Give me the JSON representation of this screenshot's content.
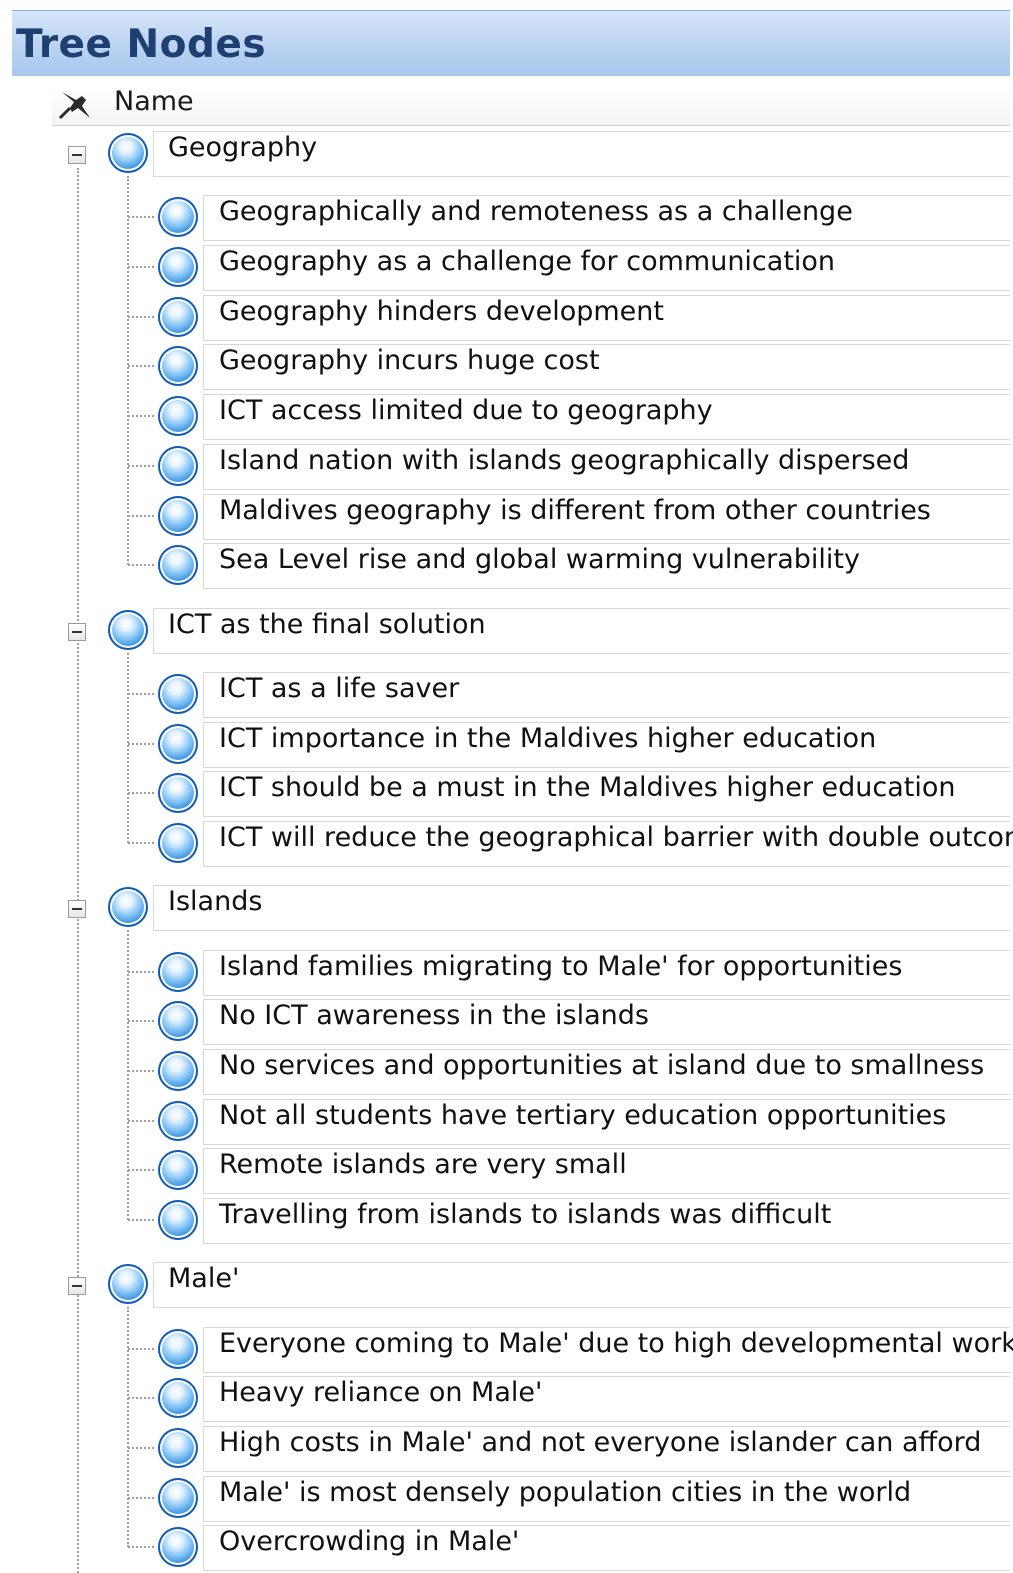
{
  "title": "Tree Nodes",
  "header": {
    "column_name": "Name"
  },
  "groups": [
    {
      "label": "Geography",
      "children": [
        "Geographically and remoteness as a challenge",
        "Geography as a challenge for communication",
        "Geography hinders development",
        "Geography incurs huge cost",
        "ICT access limited due to geography",
        "Island nation with islands geographically dispersed",
        "Maldives geography is different from other countries",
        "Sea Level rise and global warming vulnerability"
      ]
    },
    {
      "label": "ICT as the final solution",
      "children": [
        "ICT as a life saver",
        "ICT importance in the Maldives higher education",
        "ICT should be a must in the Maldives higher education",
        "ICT will reduce the geographical barrier with double outcome"
      ]
    },
    {
      "label": "Islands",
      "children": [
        "Island families migrating to Male' for opportunities",
        "No ICT awareness in the islands",
        "No services and opportunities at island due to smallness",
        "Not all students have tertiary education opportunities",
        "Remote islands are very small",
        "Travelling from islands to islands was difficult"
      ]
    },
    {
      "label": "Male'",
      "children": [
        "Everyone coming to Male' due to high developmental work",
        "Heavy reliance on Male'",
        "High costs in Male' and not everyone islander can afford",
        "Male' is most densely population cities in the world",
        "Overcrowding in Male'"
      ]
    }
  ],
  "icons": {
    "node": "blue-sphere-node-icon",
    "pin": "pin-icon",
    "expander": "collapse-minus-icon"
  },
  "colors": {
    "title_text": "#1e3f72",
    "title_bg": "#bdd4f2",
    "node_icon": "#1f7ed6"
  }
}
